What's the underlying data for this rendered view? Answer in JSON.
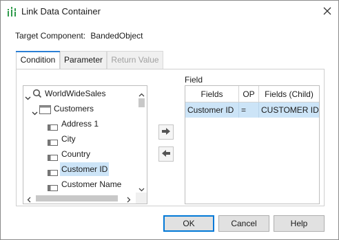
{
  "window": {
    "title": "Link Data Container",
    "app_icon": "chart-bars-icon",
    "close_icon": "close-icon"
  },
  "target": {
    "label": "Target Component:",
    "value": "BandedObject"
  },
  "tabs": [
    {
      "label": "Condition",
      "state": "active"
    },
    {
      "label": "Parameter",
      "state": "normal"
    },
    {
      "label": "Return Value",
      "state": "disabled"
    }
  ],
  "tree": {
    "root": {
      "label": "WorldWideSales",
      "icon": "query-icon",
      "expanded": true
    },
    "table": {
      "label": "Customers",
      "icon": "table-icon",
      "expanded": true
    },
    "fields": [
      {
        "label": "Address 1",
        "icon": "field-icon",
        "selected": false
      },
      {
        "label": "City",
        "icon": "field-icon",
        "selected": false
      },
      {
        "label": "Country",
        "icon": "field-icon",
        "selected": false
      },
      {
        "label": "Customer ID",
        "icon": "field-icon",
        "selected": true
      },
      {
        "label": "Customer Name",
        "icon": "field-icon",
        "selected": false
      }
    ]
  },
  "move_buttons": {
    "add_icon": "arrow-right-icon",
    "remove_icon": "arrow-left-icon"
  },
  "field_panel": {
    "label": "Field",
    "columns": [
      "Fields (Parent)",
      "OP",
      "Fields (Child)"
    ],
    "rows": [
      [
        "Customer ID",
        "=",
        "CUSTOMER ID"
      ]
    ]
  },
  "buttons": {
    "ok": "OK",
    "cancel": "Cancel",
    "help": "Help"
  },
  "colors": {
    "accent": "#0078d7",
    "selection": "#cce4f7",
    "tab_indicator": "#2a7fd4"
  }
}
